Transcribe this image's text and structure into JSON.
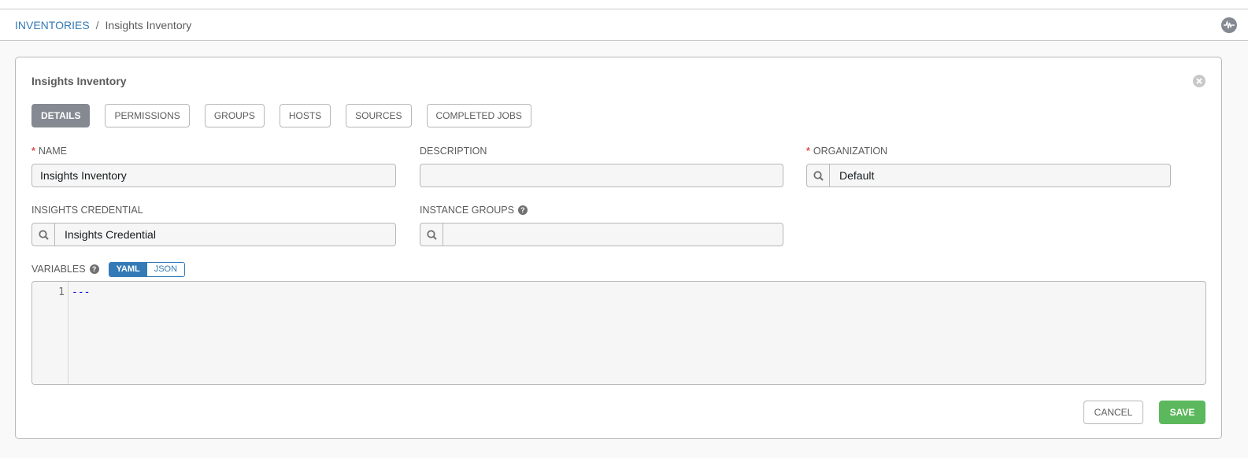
{
  "breadcrumb": {
    "parent": "INVENTORIES",
    "separator": "/",
    "current": "Insights Inventory"
  },
  "header": {
    "activity_icon": "activity-stream-icon"
  },
  "panel": {
    "title": "Insights Inventory",
    "close_icon": "close-icon",
    "tabs": [
      {
        "label": "DETAILS",
        "active": true
      },
      {
        "label": "PERMISSIONS",
        "active": false
      },
      {
        "label": "GROUPS",
        "active": false
      },
      {
        "label": "HOSTS",
        "active": false
      },
      {
        "label": "SOURCES",
        "active": false
      },
      {
        "label": "COMPLETED JOBS",
        "active": false
      }
    ]
  },
  "form": {
    "name": {
      "label": "NAME",
      "required": true,
      "value": "Insights Inventory"
    },
    "description": {
      "label": "DESCRIPTION",
      "required": false,
      "value": ""
    },
    "organization": {
      "label": "ORGANIZATION",
      "required": true,
      "value": "Default"
    },
    "insights_credential": {
      "label": "INSIGHTS CREDENTIAL",
      "value": "Insights Credential"
    },
    "instance_groups": {
      "label": "INSTANCE GROUPS",
      "value": "",
      "help": "?"
    },
    "variables": {
      "label": "VARIABLES",
      "help": "?",
      "mode_options": [
        "YAML",
        "JSON"
      ],
      "selected_mode": "YAML",
      "lines": [
        {
          "number": "1",
          "text": "---"
        }
      ]
    }
  },
  "actions": {
    "cancel_label": "CANCEL",
    "save_label": "SAVE"
  },
  "colors": {
    "link": "#337ab7",
    "active_tab": "#848992",
    "required": "#d9534f",
    "save": "#5cb85c"
  }
}
